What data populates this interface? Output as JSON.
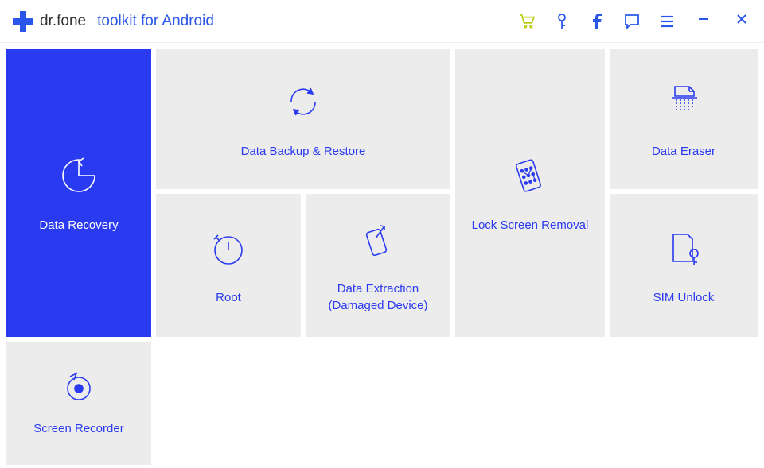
{
  "brand": "dr.fone",
  "subtitle": "toolkit for Android",
  "tiles": {
    "data_recovery": "Data Recovery",
    "backup": "Data Backup & Restore",
    "root": "Root",
    "extraction": "Data Extraction (Damaged Device)",
    "lock": "Lock Screen Removal",
    "eraser": "Data Eraser",
    "sim": "SIM Unlock",
    "recorder": "Screen Recorder"
  },
  "icons": {
    "cart": "cart-icon",
    "key": "key-icon",
    "facebook": "facebook-icon",
    "feedback": "chat-icon",
    "menu": "menu-icon",
    "minimize": "minimize-icon",
    "close": "close-icon"
  }
}
